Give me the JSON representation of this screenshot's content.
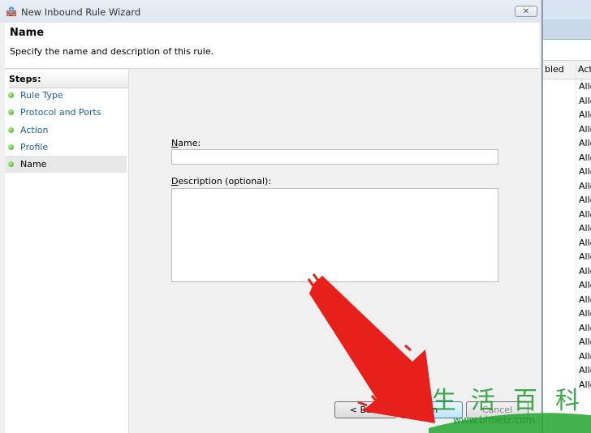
{
  "background_window": {
    "col1_label": "bled",
    "col2_label": "Act",
    "row_values": [
      "Allo",
      "Allo",
      "Allo",
      "Allo",
      "Allo",
      "Allo",
      "Allo",
      "Allo",
      "Allo",
      "Allo",
      "Allo",
      "Allo",
      "Allo",
      "Allo",
      "Allo",
      "Allo",
      "Allo",
      "Allo",
      "Allo",
      "Allo",
      "Allo",
      "Allo"
    ]
  },
  "wizard": {
    "title": "New Inbound Rule Wizard",
    "close_label": "✕",
    "header_title": "Name",
    "header_subtitle": "Specify the name and description of this rule.",
    "steps_title": "Steps:",
    "steps": [
      {
        "label": "Rule Type"
      },
      {
        "label": "Protocol and Ports"
      },
      {
        "label": "Action"
      },
      {
        "label": "Profile"
      },
      {
        "label": "Name"
      }
    ],
    "name_label_key": "N",
    "name_label_rest": "ame:",
    "name_value": "",
    "description_label_key": "D",
    "description_label_rest": "escription (optional):",
    "description_value": "",
    "back_label": "< Back",
    "finish_label": "Fin",
    "cancel_label": "Cancel"
  },
  "watermark": {
    "chars": [
      "生",
      "活",
      "百",
      "科"
    ],
    "url": "www.bimeiz.com"
  },
  "colors": {
    "step_link": "#1f5fa8",
    "arrow_red": "#e8201c",
    "watermark_green": "#1e9a2e"
  }
}
